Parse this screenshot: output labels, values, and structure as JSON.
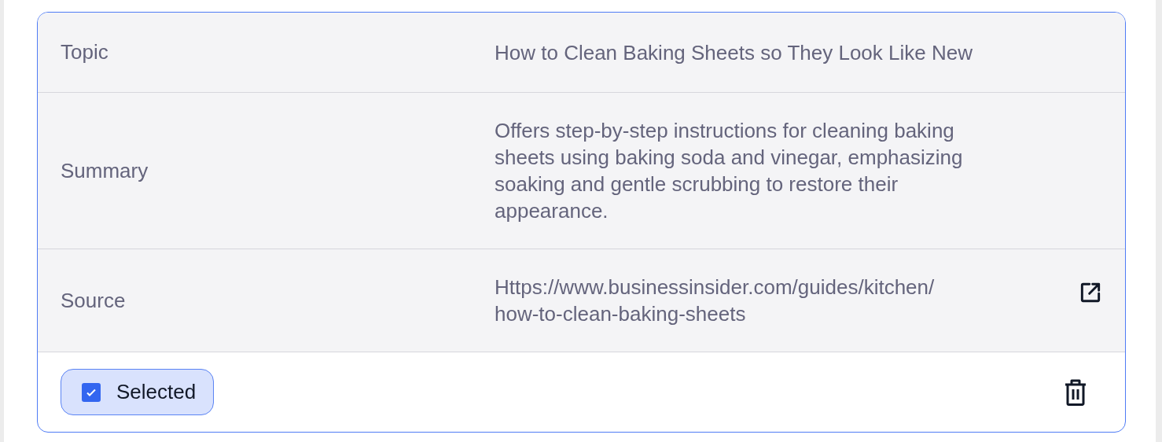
{
  "rows": [
    {
      "kind": "text",
      "label": "Topic",
      "value": "How to Clean Baking Sheets so They Look Like New"
    },
    {
      "kind": "text",
      "label": "Summary",
      "value": "Offers step-by-step instructions for cleaning baking sheets using baking soda and vinegar, emphasizing soaking and gentle scrubbing to restore their appearance."
    },
    {
      "kind": "link",
      "label": "Source",
      "value": "Https://www.businessinsider.com/guides/kitchen/how-to-clean-baking-sheets"
    }
  ],
  "footer": {
    "toggle": {
      "label": "Selected",
      "checked": true
    }
  }
}
